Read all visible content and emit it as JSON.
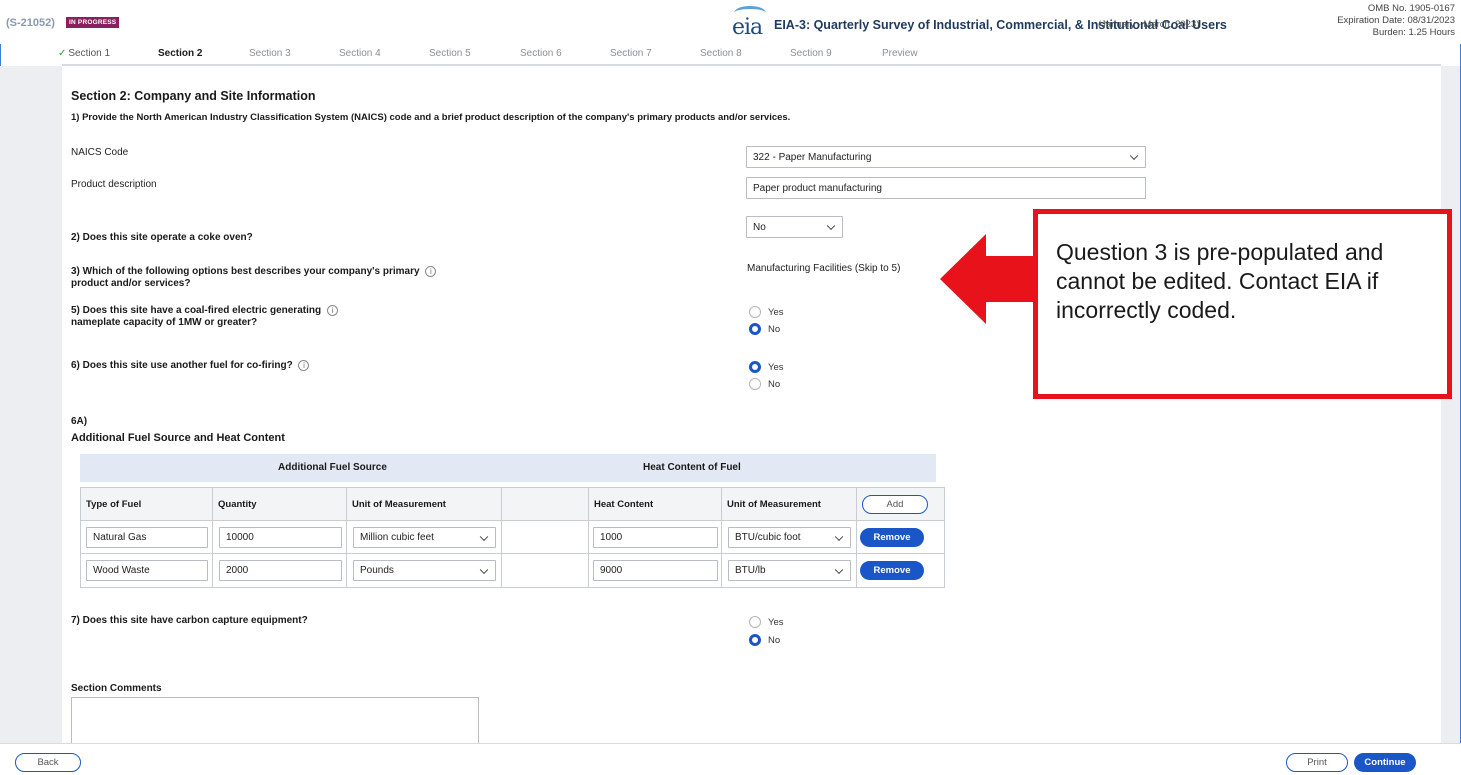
{
  "header": {
    "case_id": "(S-21052)",
    "status": "IN PROGRESS",
    "logo_text": "eia",
    "form_title": "EIA-3: Quarterly Survey of Industrial, Commercial, & Institutional Coal Users",
    "period": "(January - March, 2023)",
    "omb_number": "OMB No. 1905-0167",
    "expiration": "Expiration Date: 08/31/2023",
    "burden": "Burden: 1.25 Hours"
  },
  "tabs": [
    "Section 1",
    "Section 2",
    "Section 3",
    "Section 4",
    "Section 5",
    "Section 6",
    "Section 7",
    "Section 8",
    "Section 9",
    "Preview"
  ],
  "section": {
    "title": "Section 2: Company and Site Information",
    "q1": "1) Provide the North American Industry Classification System (NAICS) code and a brief product description of the company's primary products and/or services.",
    "naics_label": "NAICS Code",
    "naics_value": "322 - Paper Manufacturing",
    "product_label": "Product description",
    "product_value": "Paper product manufacturing",
    "q2": "2) Does this site operate a coke oven?",
    "q2_value": "No",
    "q3_line1": "3) Which of the following options best describes your company's primary",
    "q3_line2": "product and/or services?",
    "q3_value": "Manufacturing Facilities (Skip to 5)",
    "q5_line1": "5) Does this site have a coal-fired electric generating",
    "q5_line2": "nameplate capacity of 1MW or greater?",
    "q6": "6) Does this site use another fuel for co-firing?",
    "q6a": "6A)",
    "q6a_title": "Additional Fuel Source and Heat Content",
    "q7": "7) Does this site have carbon capture equipment?",
    "comments_label": "Section Comments",
    "yes": "Yes",
    "no": "No",
    "info_glyph": "i"
  },
  "callout": {
    "text": "Question 3 is pre-populated and cannot be edited. Contact EIA if incorrectly coded."
  },
  "table": {
    "group_left": "Additional Fuel Source",
    "group_right": "Heat Content of Fuel",
    "columns": [
      "Type of Fuel",
      "Quantity",
      "Unit of Measurement",
      "",
      "Heat Content",
      "Unit of Measurement"
    ],
    "add_label": "Add",
    "remove_label": "Remove",
    "rows": [
      {
        "fuel": "Natural Gas",
        "quantity": "10000",
        "unit": "Million cubic feet",
        "heat": "1000",
        "heat_unit": "BTU/cubic foot"
      },
      {
        "fuel": "Wood Waste",
        "quantity": "2000",
        "unit": "Pounds",
        "heat": "9000",
        "heat_unit": "BTU/lb"
      }
    ]
  },
  "footer": {
    "back": "Back",
    "print": "Print",
    "continue": "Continue"
  },
  "colors": {
    "accent": "#1a56c8",
    "status_badge": "#8a1f5b",
    "callout_red": "#e8121a",
    "check_green": "#2e9a3a"
  }
}
